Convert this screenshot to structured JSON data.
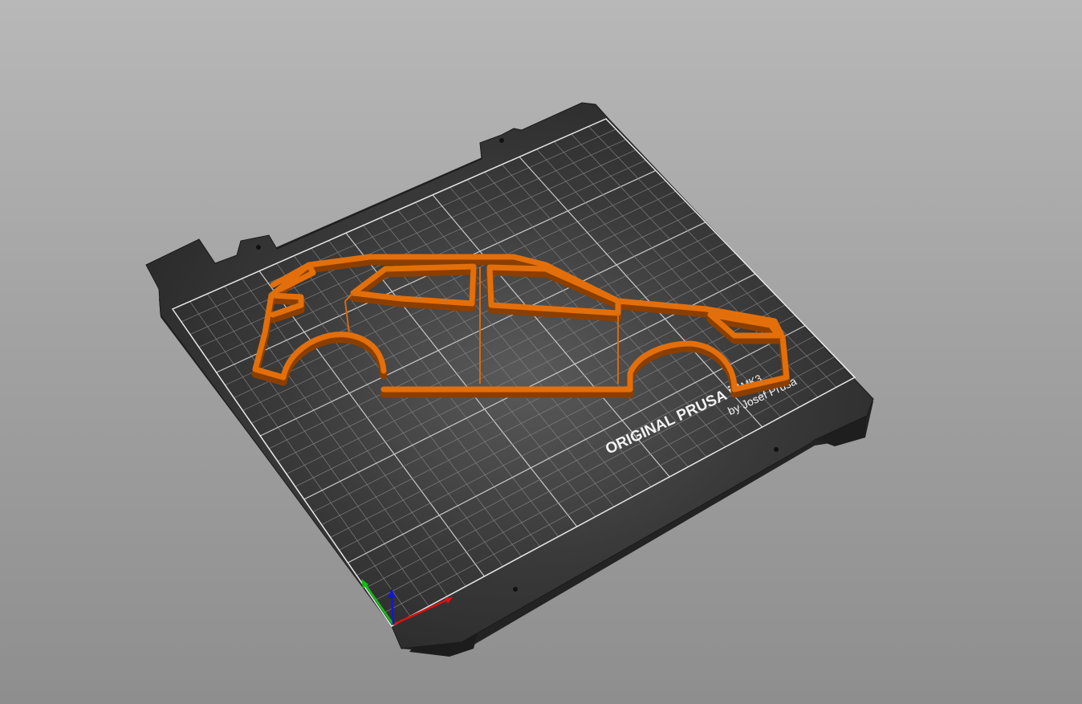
{
  "app": {
    "view": "3D plater viewport"
  },
  "bed": {
    "brand_line": "ORIGINAL PRUSA i3",
    "model_badge": "MK3",
    "maker_line": "by Josef Prusa"
  },
  "object": {
    "color": "#d9690a"
  },
  "colors": {
    "background_top": "#b8b8b8",
    "background_bottom": "#8e8e8e",
    "bed_surface": "#2e2e2e",
    "grid_line": "#8a8a8a",
    "axis_x": "#e01010",
    "axis_y": "#10c010",
    "axis_z": "#1010e0"
  },
  "axes": {
    "x_label": "x-axis",
    "y_label": "y-axis",
    "z_label": "z-axis"
  }
}
